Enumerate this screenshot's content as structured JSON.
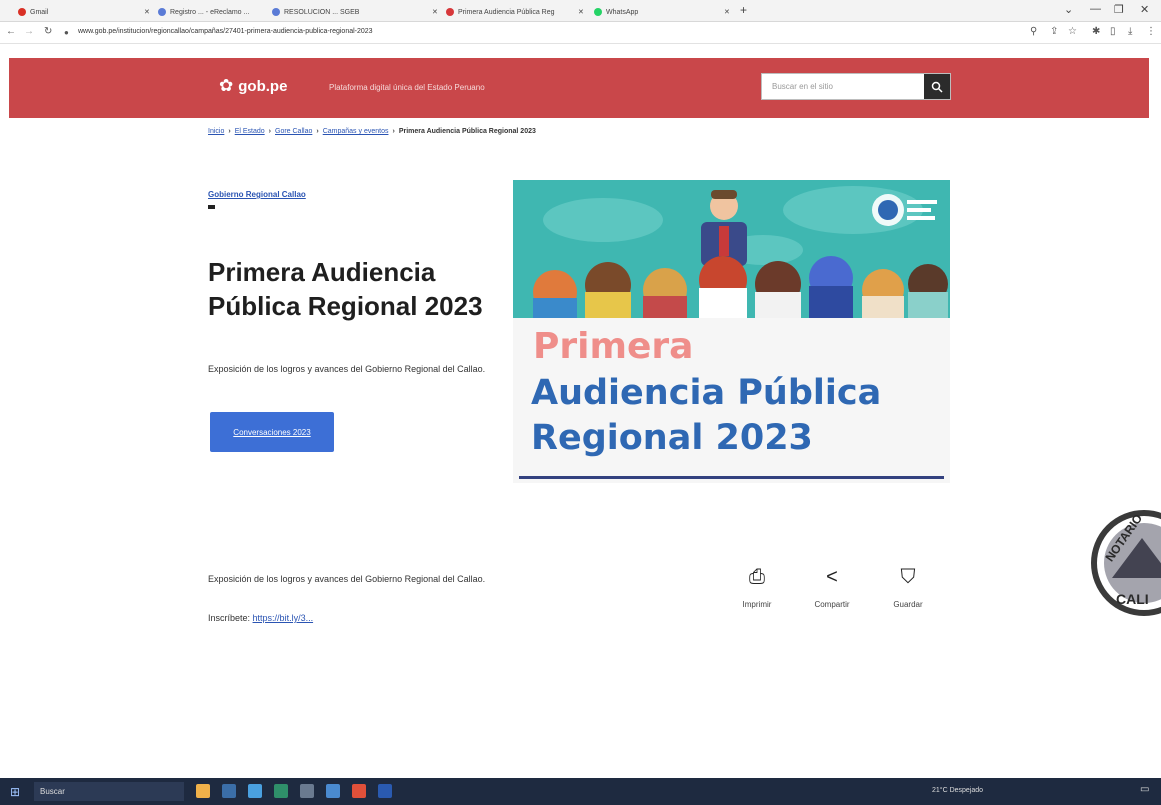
{
  "browser": {
    "tabs": [
      {
        "label": "Gmail",
        "color": "#d93025"
      },
      {
        "label": "Registro ... - eReclamo ..."
      },
      {
        "label": "RESOLUCION ... SGEB"
      },
      {
        "label": "Primera Audiencia Pública Reg"
      },
      {
        "label": "WhatsApp"
      }
    ],
    "url": "www.gob.pe/institucion/regioncallao/campañas/27401-primera-audiencia-publica-regional-2023"
  },
  "header": {
    "logo_text": "gob.pe",
    "tagline": "Plataforma digital única del Estado Peruano",
    "search_placeholder": "Buscar en el sitio",
    "search_icon": "search-icon"
  },
  "breadcrumb": {
    "items": [
      "Inicio",
      "El Estado",
      "Gore Callao",
      "Campañas y eventos"
    ],
    "current": "Primera Audiencia Pública Regional 2023"
  },
  "hero": {
    "organization": "Gobierno Regional Callao",
    "title": "Primera Audiencia Pública Regional 2023",
    "summary": "Exposición de los logros y avances del Gobierno Regional del Callao.",
    "cta_label": "Conversaciones 2023",
    "banner": {
      "line1": "Primera",
      "line2": "Audiencia Pública",
      "line3": "Regional 2023",
      "colors": {
        "teal": "#3fb7b1",
        "pink": "#ef8e8a",
        "blue": "#2f68b3"
      }
    }
  },
  "body": {
    "description": "Exposición de los logros y avances del Gobierno Regional del Callao.",
    "signup_prefix": "Inscríbete:",
    "signup_link": "https://bit.ly/3..."
  },
  "actions": [
    {
      "label": "Imprimir",
      "icon": "print-icon"
    },
    {
      "label": "Compartir",
      "icon": "share-icon"
    },
    {
      "label": "Guardar",
      "icon": "bookmark-icon"
    }
  ],
  "taskbar": {
    "search_label": "Buscar",
    "weather": "21°C Despejado"
  },
  "stamp": {
    "text_top": "NOTARIO",
    "text_bottom": "CALL"
  }
}
